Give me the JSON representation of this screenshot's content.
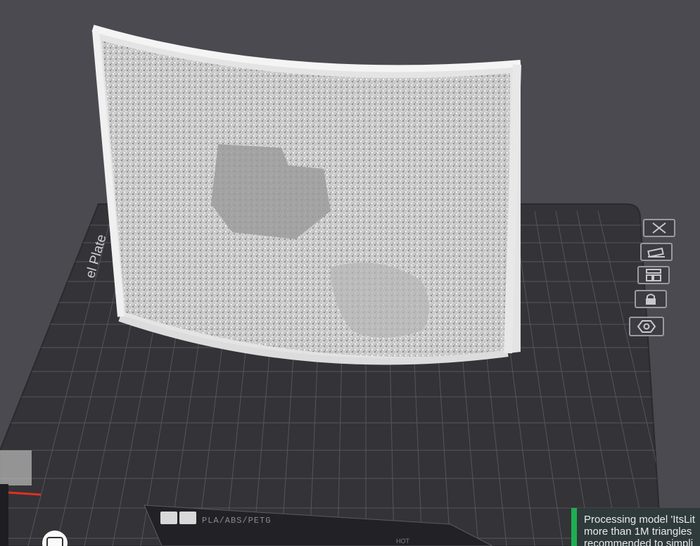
{
  "plate": {
    "label": "el Plate",
    "filament_tag": "PLA/ABS/PETG",
    "hot_tag": "HOT"
  },
  "plate_toolbar": [
    {
      "name": "remove-plate-button",
      "icon": "close-icon"
    },
    {
      "name": "auto-orient-button",
      "icon": "orient-icon"
    },
    {
      "name": "arrange-button",
      "icon": "arrange-icon"
    },
    {
      "name": "lock-plate-button",
      "icon": "lock-icon"
    },
    {
      "name": "plate-settings-button",
      "icon": "settings-icon"
    }
  ],
  "notification": {
    "message": "Processing model 'ItsLit\nmore than 1M triangles\nrecommended to simpli"
  },
  "colors": {
    "background": "#4a4a50",
    "plate": "#333338",
    "grid": "#55555c",
    "model": "#cfcfcf",
    "notification_accent": "#1fae52"
  }
}
